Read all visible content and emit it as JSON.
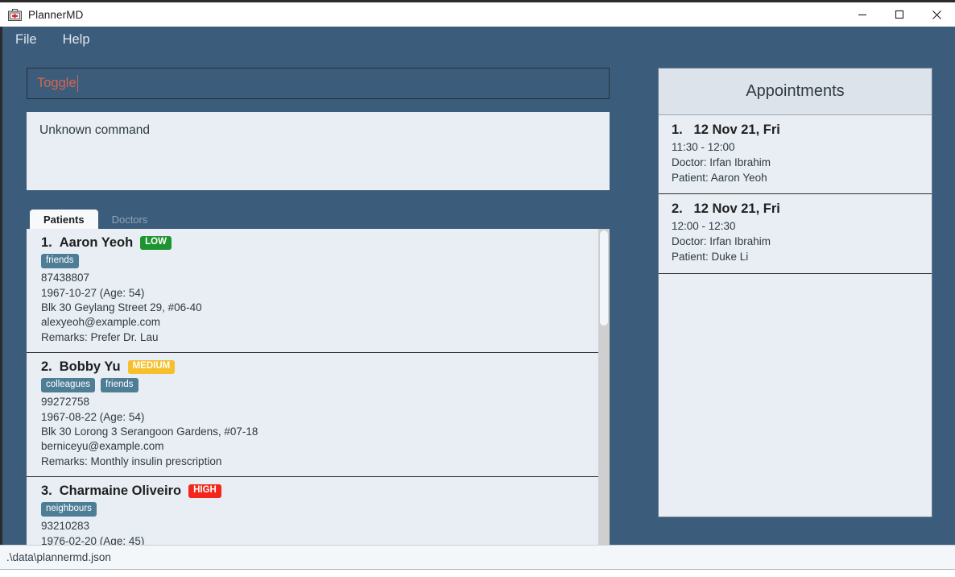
{
  "window": {
    "title": "PlannerMD",
    "icon": "medical-kit-icon",
    "minimize_label": "—",
    "maximize_label": "☐",
    "close_label": "✕"
  },
  "menubar": {
    "items": [
      {
        "label": "File"
      },
      {
        "label": "Help"
      }
    ]
  },
  "command": {
    "value": "Toggle",
    "text_color": "#d4674e"
  },
  "result": {
    "text": "Unknown command"
  },
  "tabs": [
    {
      "label": "Patients",
      "active": true
    },
    {
      "label": "Doctors",
      "active": false
    }
  ],
  "patients": [
    {
      "index": "1.",
      "name": "Aaron Yeoh",
      "risk": "LOW",
      "risk_class": "low",
      "tags": [
        "friends"
      ],
      "phone": "87438807",
      "dob": "1967-10-27 (Age: 54)",
      "address": "Blk 30 Geylang Street 29, #06-40",
      "email": "alexyeoh@example.com",
      "remarks": "Remarks: Prefer Dr. Lau"
    },
    {
      "index": "2.",
      "name": "Bobby Yu",
      "risk": "MEDIUM",
      "risk_class": "medium",
      "tags": [
        "colleagues",
        "friends"
      ],
      "phone": "99272758",
      "dob": "1967-08-22 (Age: 54)",
      "address": "Blk 30 Lorong 3 Serangoon Gardens, #07-18",
      "email": "berniceyu@example.com",
      "remarks": "Remarks: Monthly insulin prescription"
    },
    {
      "index": "3.",
      "name": "Charmaine Oliveiro",
      "risk": "HIGH",
      "risk_class": "high",
      "tags": [
        "neighbours"
      ],
      "phone": "93210283",
      "dob": "1976-02-20 (Age: 45)",
      "address": "",
      "email": "",
      "remarks": ""
    }
  ],
  "appointments": {
    "title": "Appointments",
    "items": [
      {
        "index": "1.",
        "date": "12 Nov 21, Fri",
        "time": "11:30 - 12:00",
        "doctor": "Doctor: Irfan Ibrahim",
        "patient": "Patient: Aaron Yeoh"
      },
      {
        "index": "2.",
        "date": "12 Nov 21, Fri",
        "time": "12:00 - 12:30",
        "doctor": "Doctor: Irfan Ibrahim",
        "patient": "Patient: Duke Li"
      }
    ]
  },
  "statusbar": {
    "path": ".\\data\\plannermd.json"
  },
  "colors": {
    "window_background": "#3c5c7c",
    "panel_background": "#e8eef4",
    "header_background": "#dde3ea",
    "risk_low": "#1e9430",
    "risk_medium": "#f5c02b",
    "risk_high": "#f4251a",
    "tag": "#4e7e96",
    "command_text": "#d4674e"
  }
}
